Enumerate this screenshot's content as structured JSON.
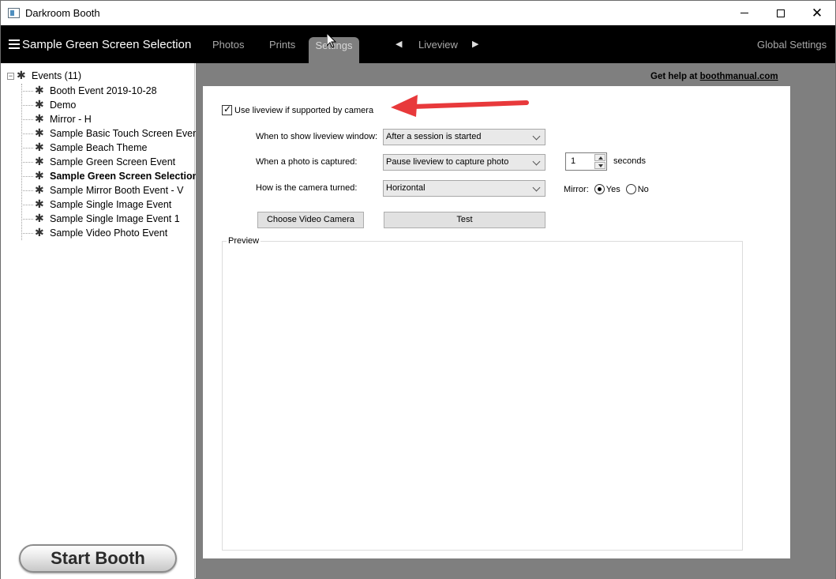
{
  "window": {
    "title": "Darkroom Booth",
    "minimize_icon": "minimize-icon",
    "maximize_icon": "maximize-icon",
    "close_icon": "close-icon",
    "close_glyph": "✕"
  },
  "menubar": {
    "menu_icon": "hamburger-menu-icon",
    "event_name": "Sample Green Screen Selection",
    "tabs": [
      {
        "label": "Photos",
        "active": false
      },
      {
        "label": "Prints",
        "active": false
      },
      {
        "label": "Settings",
        "active": true
      }
    ],
    "liveview_label": "Liveview",
    "prev_glyph": "◀",
    "next_glyph": "▶",
    "global_settings_label": "Global Settings"
  },
  "tree": {
    "collapse_glyph": "−",
    "root_label": "Events (11)",
    "item_icon": "event-icon",
    "items": [
      {
        "label": "Booth Event 2019-10-28",
        "selected": false
      },
      {
        "label": "Demo",
        "selected": false
      },
      {
        "label": "Mirror - H",
        "selected": false
      },
      {
        "label": "Sample Basic Touch Screen Event",
        "selected": false
      },
      {
        "label": "Sample Beach Theme",
        "selected": false
      },
      {
        "label": "Sample Green Screen Event",
        "selected": false
      },
      {
        "label": "Sample Green Screen Selection",
        "selected": true
      },
      {
        "label": "Sample Mirror Booth Event - V",
        "selected": false
      },
      {
        "label": "Sample Single Image Event",
        "selected": false
      },
      {
        "label": "Sample Single Image Event  1",
        "selected": false
      },
      {
        "label": "Sample Video Photo Event",
        "selected": false
      }
    ]
  },
  "start_booth_label": "Start Booth",
  "help": {
    "prefix": "Get help at ",
    "link": "boothmanual.com"
  },
  "liveview_settings": {
    "use_liveview_label": "Use liveview if supported by camera",
    "use_liveview_checked": true,
    "show_window_label": "When to show liveview window:",
    "show_window_value": "After a session is started",
    "photo_captured_label": "When a photo is captured:",
    "photo_captured_value": "Pause liveview to capture photo",
    "pause_seconds_value": "1",
    "seconds_label": "seconds",
    "camera_turned_label": "How is the camera turned:",
    "camera_turned_value": "Horizontal",
    "mirror_label": "Mirror:",
    "mirror_yes_label": "Yes",
    "mirror_no_label": "No",
    "mirror_selected": "Yes",
    "choose_camera_label": "Choose Video Camera",
    "test_label": "Test",
    "preview_label": "Preview"
  },
  "colors": {
    "menubar_bg": "#000000",
    "content_bg": "#7f7f7f",
    "active_tab_bg": "#7f7f7f",
    "annotation_arrow": "#e8393b"
  }
}
